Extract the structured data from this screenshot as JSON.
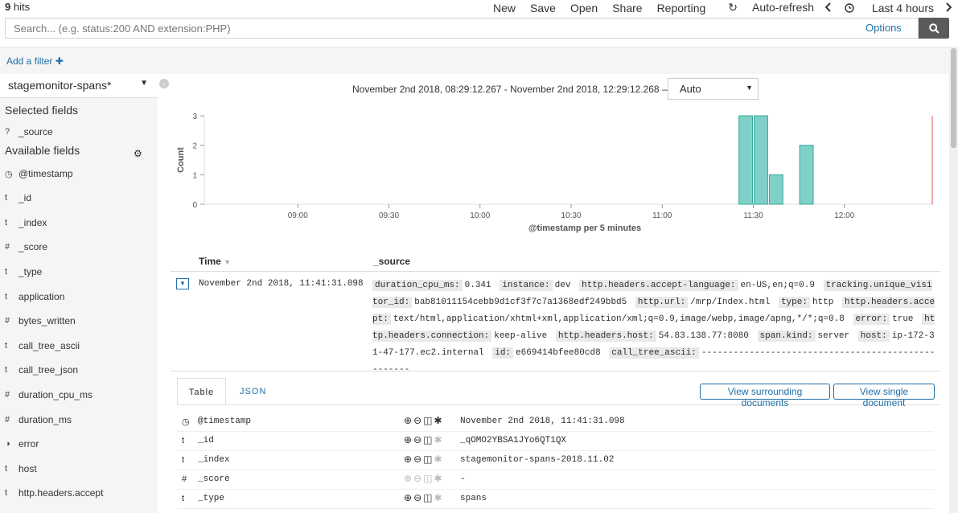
{
  "topbar": {
    "hits_count": "9",
    "hits_label": "hits",
    "nav": [
      "New",
      "Save",
      "Open",
      "Share",
      "Reporting"
    ],
    "auto_refresh": "Auto-refresh",
    "time_label": "Last 4 hours"
  },
  "search": {
    "placeholder": "Search... (e.g. status:200 AND extension:PHP)",
    "options_label": "Options"
  },
  "filter": {
    "add_label": "Add a filter"
  },
  "sidebar": {
    "index_pattern": "stagemonitor-spans*",
    "selected_heading": "Selected fields",
    "selected_fields": [
      {
        "type": "?",
        "name": "_source"
      }
    ],
    "available_heading": "Available fields",
    "available_fields": [
      {
        "type": "clock",
        "name": "@timestamp"
      },
      {
        "type": "t",
        "name": "_id"
      },
      {
        "type": "t",
        "name": "_index"
      },
      {
        "type": "#",
        "name": "_score"
      },
      {
        "type": "t",
        "name": "_type"
      },
      {
        "type": "t",
        "name": "application"
      },
      {
        "type": "#",
        "name": "bytes_written"
      },
      {
        "type": "t",
        "name": "call_tree_ascii"
      },
      {
        "type": "t",
        "name": "call_tree_json"
      },
      {
        "type": "#",
        "name": "duration_cpu_ms"
      },
      {
        "type": "#",
        "name": "duration_ms"
      },
      {
        "type": "bool",
        "name": "error"
      },
      {
        "type": "t",
        "name": "host"
      },
      {
        "type": "t",
        "name": "http.headers.accept"
      }
    ]
  },
  "main": {
    "time_range": "November 2nd 2018, 08:29:12.267 - November 2nd 2018, 12:29:12.268 —",
    "interval": "Auto"
  },
  "chart_data": {
    "type": "bar",
    "xlabel": "@timestamp per 5 minutes",
    "ylabel": "Count",
    "x_ticks": [
      "09:00",
      "09:30",
      "10:00",
      "10:30",
      "11:00",
      "11:30",
      "12:00"
    ],
    "x_tick_minutes": [
      540,
      570,
      600,
      630,
      660,
      690,
      720
    ],
    "xlim_minutes": [
      509.2,
      749.2
    ],
    "y_ticks": [
      0,
      1,
      2,
      3
    ],
    "ylim": [
      0,
      3
    ],
    "bars": [
      {
        "start_minute": 685,
        "value": 3
      },
      {
        "start_minute": 690,
        "value": 3
      },
      {
        "start_minute": 695,
        "value": 1
      },
      {
        "start_minute": 705,
        "value": 2
      }
    ],
    "bar_color": "#7fd1c8",
    "bar_stroke": "#3aa79a",
    "now_marker_minute": 749.2,
    "now_marker_color": "#e86d6d"
  },
  "table": {
    "col_time": "Time",
    "col_source": "_source",
    "row": {
      "time": "November 2nd 2018, 11:41:31.098",
      "source": [
        {
          "k": "duration_cpu_ms:",
          "v": "0.341"
        },
        {
          "k": "instance:",
          "v": "dev"
        },
        {
          "k": "http.headers.accept-language:",
          "v": "en-US,en;q=0.9"
        },
        {
          "k": "tracking.unique_visitor_id:",
          "v": "bab81011154cebb9d1cf3f7c7a1368edf249bbd5"
        },
        {
          "k": "http.url:",
          "v": "/mrp/Index.html"
        },
        {
          "k": "type:",
          "v": "http"
        },
        {
          "k": "http.headers.accept:",
          "v": "text/html,application/xhtml+xml,application/xml;q=0.9,image/webp,image/apng,*/*;q=0.8"
        },
        {
          "k": "error:",
          "v": "true"
        },
        {
          "k": "http.headers.connection:",
          "v": "keep-alive"
        },
        {
          "k": "http.headers.host:",
          "v": "54.83.138.77:8080"
        },
        {
          "k": "span.kind:",
          "v": "server"
        },
        {
          "k": "host:",
          "v": "ip-172-31-47-177.ec2.internal"
        },
        {
          "k": "id:",
          "v": "e669414bfee80cd8"
        },
        {
          "k": "call_tree_ascii:",
          "v": "---------------------------------------------------"
        }
      ]
    }
  },
  "detail": {
    "tab_table": "Table",
    "tab_json": "JSON",
    "view_surrounding": "View surrounding documents",
    "view_single": "View single document",
    "rows": [
      {
        "type": "clock",
        "name": "@timestamp",
        "value": "November 2nd 2018, 11:41:31.098",
        "dim": false
      },
      {
        "type": "t",
        "name": "_id",
        "value": "_qOMO2YBSA1JYo6QT1QX",
        "dim": false
      },
      {
        "type": "t",
        "name": "_index",
        "value": "stagemonitor-spans-2018.11.02",
        "dim": false
      },
      {
        "type": "#",
        "name": "_score",
        "value": "-",
        "dim": true
      },
      {
        "type": "t",
        "name": "_type",
        "value": "spans",
        "dim": false
      }
    ]
  }
}
